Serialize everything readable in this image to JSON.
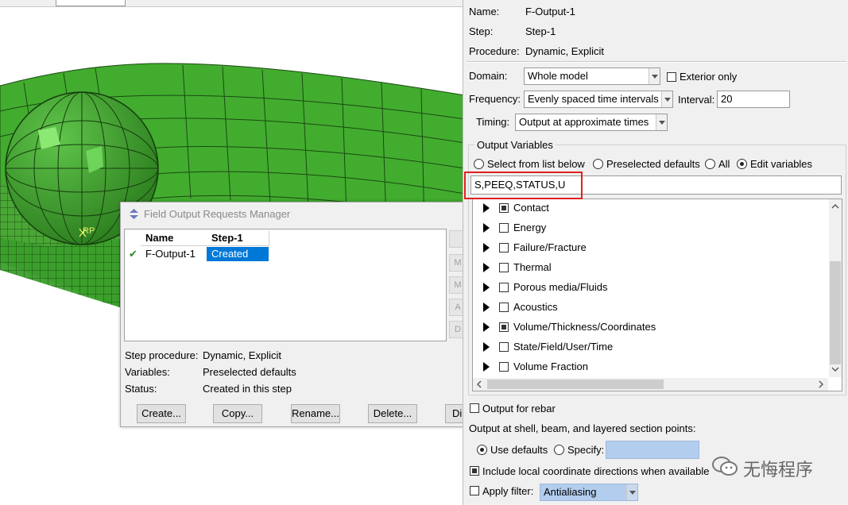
{
  "viewport": {
    "rp_label": "RP"
  },
  "manager": {
    "title": "Field Output Requests Manager",
    "columns": [
      "Name",
      "Step-1"
    ],
    "rows": [
      {
        "check": "✔",
        "name": "F-Output-1",
        "step": "Created"
      }
    ],
    "side_buttons": [
      "",
      "M",
      "M",
      "A",
      "D"
    ],
    "info": {
      "procedure_label": "Step procedure:",
      "procedure_value": "Dynamic, Explicit",
      "variables_label": "Variables:",
      "variables_value": "Preselected defaults",
      "status_label": "Status:",
      "status_value": "Created in this step"
    },
    "buttons": {
      "create": "Create...",
      "copy": "Copy...",
      "rename": "Rename...",
      "delete": "Delete...",
      "dismiss": "Di"
    }
  },
  "editor": {
    "name_label": "Name:",
    "name_value": "F-Output-1",
    "step_label": "Step:",
    "step_value": "Step-1",
    "procedure_label": "Procedure:",
    "procedure_value": "Dynamic, Explicit",
    "domain_label": "Domain:",
    "domain_value": "Whole model",
    "exterior_only": "Exterior only",
    "frequency_label": "Frequency:",
    "frequency_value": "Evenly spaced time intervals",
    "interval_label": "Interval:",
    "interval_value": "20",
    "timing_label": "Timing:",
    "timing_value": "Output at approximate times",
    "output_variables_label": "Output Variables",
    "radio_select": "Select from list below",
    "radio_preselected": "Preselected defaults",
    "radio_all": "All",
    "radio_edit": "Edit variables",
    "variables_text": "S,PEEQ,STATUS,U",
    "tree_items": [
      "Contact",
      "Energy",
      "Failure/Fracture",
      "Thermal",
      "Porous media/Fluids",
      "Acoustics",
      "Volume/Thickness/Coordinates",
      "State/Field/User/Time",
      "Volume Fraction"
    ],
    "output_rebar": "Output for rebar",
    "section_points_label": "Output at shell, beam, and layered section points:",
    "use_defaults": "Use defaults",
    "specify": "Specify:",
    "local_coord": "Include local coordinate directions when available",
    "apply_filter": "Apply filter:",
    "filter_value": "Antialiasing"
  },
  "watermark": {
    "text": "无悔程序"
  },
  "colors": {
    "mesh_green": "#3fae2c",
    "selection_blue": "#0078d7",
    "highlight_red": "#e0201f"
  }
}
